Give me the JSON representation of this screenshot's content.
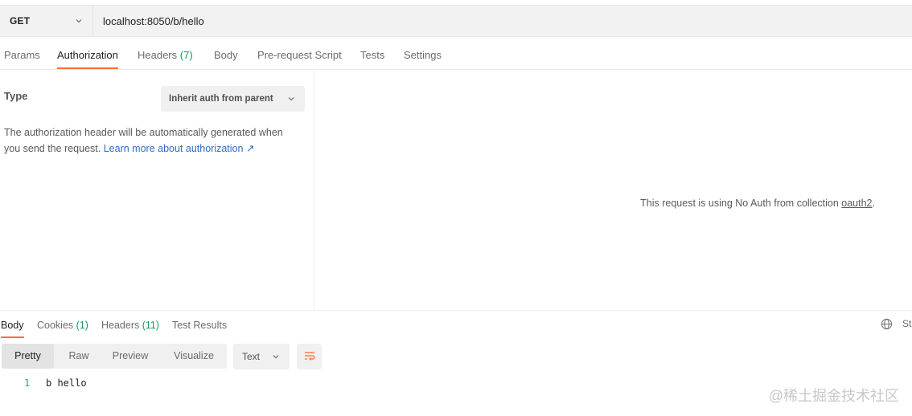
{
  "request": {
    "method": "GET",
    "url": "localhost:8050/b/hello"
  },
  "request_tabs": [
    {
      "label": "Params",
      "count": ""
    },
    {
      "label": "Authorization",
      "count": "",
      "active": true
    },
    {
      "label": "Headers",
      "count": "(7)"
    },
    {
      "label": "Body",
      "count": ""
    },
    {
      "label": "Pre-request Script",
      "count": ""
    },
    {
      "label": "Tests",
      "count": ""
    },
    {
      "label": "Settings",
      "count": ""
    }
  ],
  "auth": {
    "type_label": "Type",
    "type_value": "Inherit auth from parent",
    "description": "The authorization header will be automatically generated when you send the request.",
    "learn_more": "Learn more about authorization",
    "learn_more_arrow": "↗",
    "noauth_prefix": "This request is using No Auth from collection ",
    "collection": "oauth2",
    "noauth_suffix": "."
  },
  "response_tabs": [
    {
      "label": "Body",
      "count": "",
      "active": true
    },
    {
      "label": "Cookies",
      "count": "(1)"
    },
    {
      "label": "Headers",
      "count": "(11)"
    },
    {
      "label": "Test Results",
      "count": ""
    }
  ],
  "status_truncated": "St",
  "view_modes": [
    "Pretty",
    "Raw",
    "Preview",
    "Visualize"
  ],
  "active_view_mode": "Pretty",
  "format": "Text",
  "response_body": [
    {
      "line": "1",
      "text": "b hello"
    }
  ],
  "watermark": "@稀土掘金技术社区",
  "colors": {
    "accent": "#ff6c37",
    "link": "#2d6fc4",
    "count_green": "#0a9e5a"
  },
  "icons": [
    "chevron-down-icon",
    "external-link-icon",
    "globe-icon",
    "wrap-lines-icon"
  ]
}
